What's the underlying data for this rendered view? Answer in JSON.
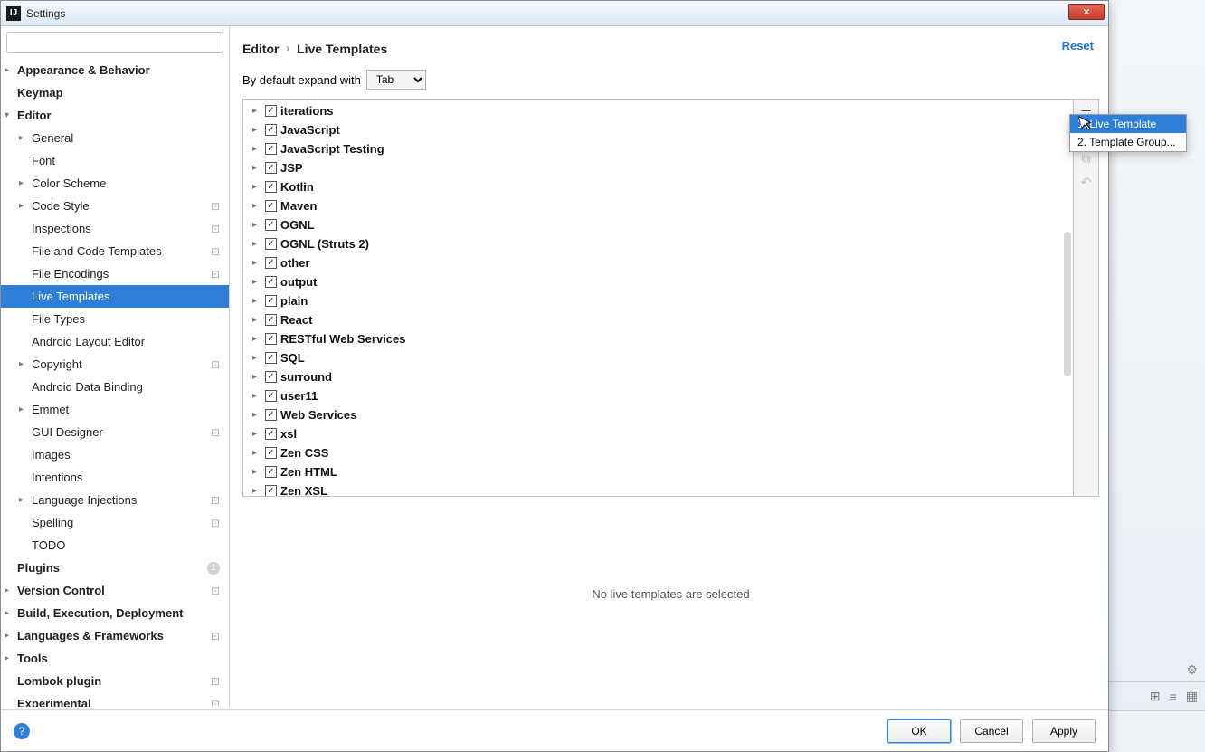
{
  "window": {
    "title": "Settings"
  },
  "breadcrumb": {
    "root": "Editor",
    "leaf": "Live Templates"
  },
  "reset_label": "Reset",
  "expand": {
    "label": "By default expand with",
    "selected": "Tab"
  },
  "sidebar": {
    "search_placeholder": "",
    "items": [
      {
        "label": "Appearance & Behavior",
        "depth": 0,
        "expandable": true,
        "bold": true
      },
      {
        "label": "Keymap",
        "depth": 0,
        "bold": true
      },
      {
        "label": "Editor",
        "depth": 0,
        "expandable": true,
        "expanded": true,
        "bold": true
      },
      {
        "label": "General",
        "depth": 1,
        "expandable": true
      },
      {
        "label": "Font",
        "depth": 1
      },
      {
        "label": "Color Scheme",
        "depth": 1,
        "expandable": true
      },
      {
        "label": "Code Style",
        "depth": 1,
        "expandable": true,
        "badge": true
      },
      {
        "label": "Inspections",
        "depth": 1,
        "badge": true
      },
      {
        "label": "File and Code Templates",
        "depth": 1,
        "badge": true
      },
      {
        "label": "File Encodings",
        "depth": 1,
        "badge": true
      },
      {
        "label": "Live Templates",
        "depth": 1,
        "selected": true
      },
      {
        "label": "File Types",
        "depth": 1
      },
      {
        "label": "Android Layout Editor",
        "depth": 1
      },
      {
        "label": "Copyright",
        "depth": 1,
        "expandable": true,
        "badge": true
      },
      {
        "label": "Android Data Binding",
        "depth": 1
      },
      {
        "label": "Emmet",
        "depth": 1,
        "expandable": true
      },
      {
        "label": "GUI Designer",
        "depth": 1,
        "badge": true
      },
      {
        "label": "Images",
        "depth": 1
      },
      {
        "label": "Intentions",
        "depth": 1
      },
      {
        "label": "Language Injections",
        "depth": 1,
        "expandable": true,
        "badge": true
      },
      {
        "label": "Spelling",
        "depth": 1,
        "badge": true
      },
      {
        "label": "TODO",
        "depth": 1
      },
      {
        "label": "Plugins",
        "depth": 0,
        "bold": true,
        "plugins_badge": true
      },
      {
        "label": "Version Control",
        "depth": 0,
        "expandable": true,
        "bold": true,
        "badge": true
      },
      {
        "label": "Build, Execution, Deployment",
        "depth": 0,
        "expandable": true,
        "bold": true
      },
      {
        "label": "Languages & Frameworks",
        "depth": 0,
        "expandable": true,
        "bold": true,
        "badge": true
      },
      {
        "label": "Tools",
        "depth": 0,
        "expandable": true,
        "bold": true
      },
      {
        "label": "Lombok plugin",
        "depth": 0,
        "bold": true,
        "badge": true
      },
      {
        "label": "Experimental",
        "depth": 0,
        "bold": true,
        "badge": true
      }
    ]
  },
  "templates": [
    {
      "label": "iterations",
      "checked": true,
      "expandable": true
    },
    {
      "label": "JavaScript",
      "checked": true,
      "expandable": true
    },
    {
      "label": "JavaScript Testing",
      "checked": true,
      "expandable": true
    },
    {
      "label": "JSP",
      "checked": true,
      "expandable": true
    },
    {
      "label": "Kotlin",
      "checked": true,
      "expandable": true
    },
    {
      "label": "Maven",
      "checked": true
    },
    {
      "label": "OGNL",
      "checked": true
    },
    {
      "label": "OGNL (Struts 2)",
      "checked": true,
      "expandable": true
    },
    {
      "label": "other",
      "checked": true
    },
    {
      "label": "output",
      "checked": true
    },
    {
      "label": "plain",
      "checked": true
    },
    {
      "label": "React",
      "checked": true
    },
    {
      "label": "RESTful Web Services",
      "checked": true,
      "expandable": true
    },
    {
      "label": "SQL",
      "checked": true
    },
    {
      "label": "surround",
      "checked": true
    },
    {
      "label": "user11",
      "checked": true,
      "expandable": true
    },
    {
      "label": "Web Services",
      "checked": true,
      "expandable": true
    },
    {
      "label": "xsl",
      "checked": true
    },
    {
      "label": "Zen CSS",
      "checked": true
    },
    {
      "label": "Zen HTML",
      "checked": true
    },
    {
      "label": "Zen XSL",
      "checked": true
    }
  ],
  "empty_hint": "No live templates are selected",
  "popup": {
    "item1": "1. Live Template",
    "item2": "2. Template Group..."
  },
  "buttons": {
    "ok": "OK",
    "cancel": "Cancel",
    "apply": "Apply"
  }
}
